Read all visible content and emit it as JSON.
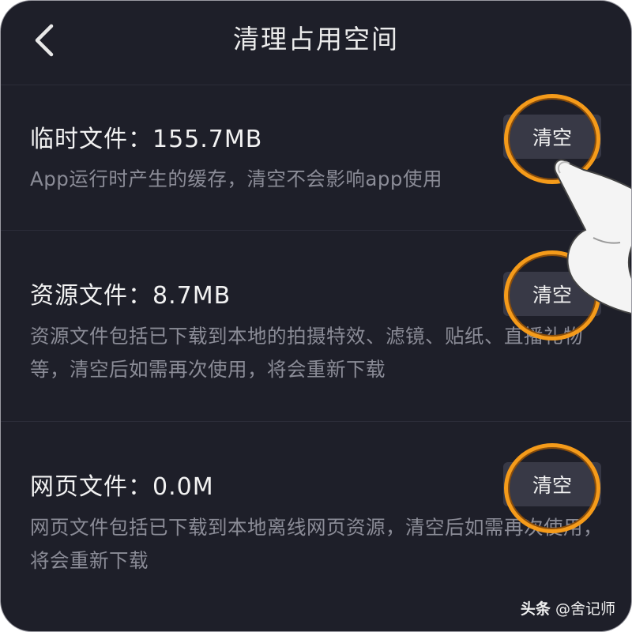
{
  "header": {
    "title": "清理占用空间"
  },
  "items": [
    {
      "title": "临时文件：155.7MB",
      "desc": "App运行时产生的缓存，清空不会影响app使用",
      "button": "清空"
    },
    {
      "title": "资源文件：8.7MB",
      "desc": "资源文件包括已下载到本地的拍摄特效、滤镜、贴纸、直播礼物等，清空后如需再次使用，将会重新下载",
      "button": "清空"
    },
    {
      "title": "网页文件：0.0M",
      "desc": "网页文件包括已下载到本地离线网页资源，清空后如需再次使用，将会重新下载",
      "button": "清空"
    }
  ],
  "watermark": {
    "brand": "头条",
    "author": "@舍记师"
  },
  "icons": {
    "back": "chevron-left-icon",
    "hand": "pointing-finger-icon"
  },
  "colors": {
    "background": "#1e1f29",
    "button": "#383946",
    "highlight": "#f59b1a",
    "secondary_text": "#8b8c97"
  }
}
